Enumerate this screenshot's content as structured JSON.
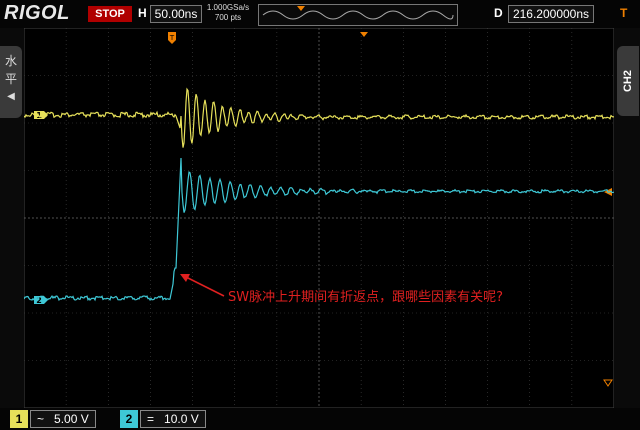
{
  "header": {
    "brand": "RIGOL",
    "run_state": "STOP",
    "timebase_label": "H",
    "timebase_value": "50.00ns",
    "sample_rate": "1.000GSa/s",
    "memory_depth": "700 pts",
    "delay_label": "D",
    "delay_value": "216.200000ns"
  },
  "left_tab": {
    "label_line1": "水",
    "label_line2": "平"
  },
  "right_tab": {
    "label": "CH2"
  },
  "channels": [
    {
      "number": "1",
      "coupling": "~",
      "scale": "5.00 V",
      "color": "#e6e05a"
    },
    {
      "number": "2",
      "coupling": "=",
      "scale": "10.0 V",
      "color": "#3ec8d6"
    }
  ],
  "annotation": {
    "text": "SW脉冲上升期间有折返点，跟哪些因素有关呢?",
    "color": "#e02020"
  },
  "colors": {
    "trigger": "#f08000",
    "grid": "#555555",
    "background": "#000000"
  }
}
